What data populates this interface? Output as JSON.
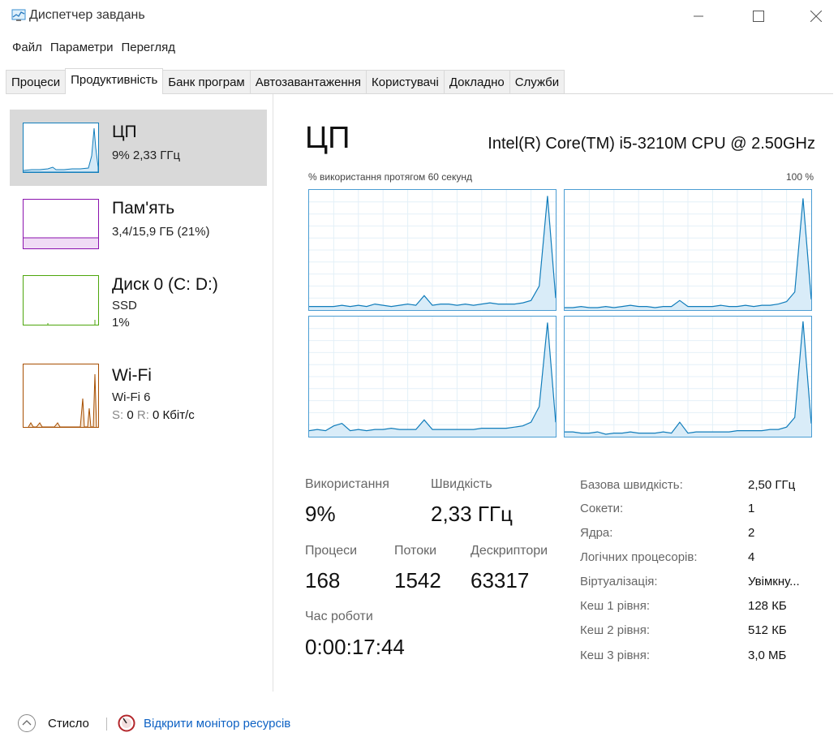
{
  "window": {
    "title": "Диспетчер завдань",
    "icons": {
      "app": "task-manager-icon",
      "minimize": "minimize-icon",
      "maximize": "maximize-icon",
      "close": "close-icon"
    }
  },
  "menu": [
    "Файл",
    "Параметри",
    "Перегляд"
  ],
  "tabs": [
    {
      "label": "Процеси",
      "active": false
    },
    {
      "label": "Продуктивність",
      "active": true
    },
    {
      "label": "Банк програм",
      "active": false
    },
    {
      "label": "Автозавантаження",
      "active": false
    },
    {
      "label": "Користувачі",
      "active": false
    },
    {
      "label": "Докладно",
      "active": false
    },
    {
      "label": "Служби",
      "active": false
    }
  ],
  "resources": [
    {
      "name": "ЦП",
      "line1": "9% 2,33 ГГц",
      "color": "#117dbb",
      "selected": true
    },
    {
      "name": "Пам'ять",
      "line1": "3,4/15,9 ГБ (21%)",
      "color": "#8b12ae",
      "selected": false
    },
    {
      "name": "Диск 0 (C: D:)",
      "line1": "SSD",
      "line2": "1%",
      "color": "#4da60c",
      "selected": false
    },
    {
      "name": "Wi-Fi",
      "line1": "Wi-Fi 6",
      "net": {
        "send_label": "S:",
        "send_value": "0",
        "recv_label": "R:",
        "recv_value": "0 Кбіт/с"
      },
      "color": "#a74f01",
      "selected": false
    }
  ],
  "main": {
    "title": "ЦП",
    "cpu_model": "Intel(R) Core(TM) i5-3210M CPU @ 2.50GHz",
    "graph_label": "% використання протягом 60 секунд",
    "graph_max": "100 %",
    "graph_color": "#117dbb"
  },
  "stats": {
    "usage_label": "Використання",
    "usage_value": "9%",
    "speed_label": "Швидкість",
    "speed_value": "2,33 ГГц",
    "processes_label": "Процеси",
    "processes_value": "168",
    "threads_label": "Потоки",
    "threads_value": "1542",
    "handles_label": "Дескриптори",
    "handles_value": "63317",
    "uptime_label": "Час роботи",
    "uptime_value": "0:00:17:44"
  },
  "specs": [
    {
      "label": "Базова швидкість:",
      "value": "2,50 ГГц"
    },
    {
      "label": "Сокети:",
      "value": "1"
    },
    {
      "label": "Ядра:",
      "value": "2"
    },
    {
      "label": "Логічних процесорів:",
      "value": "4"
    },
    {
      "label": "Віртуалізація:",
      "value": "Увімкну..."
    },
    {
      "label": "Кеш 1 рівня:",
      "value": "128 КБ"
    },
    {
      "label": "Кеш 2 рівня:",
      "value": "512 КБ"
    },
    {
      "label": "Кеш 3 рівня:",
      "value": "3,0 МБ"
    }
  ],
  "footer": {
    "fold_label": "Стисло",
    "monitor_label": "Відкрити монітор ресурсів",
    "icons": {
      "fold": "chevron-up-icon",
      "monitor": "resource-monitor-icon"
    }
  }
}
